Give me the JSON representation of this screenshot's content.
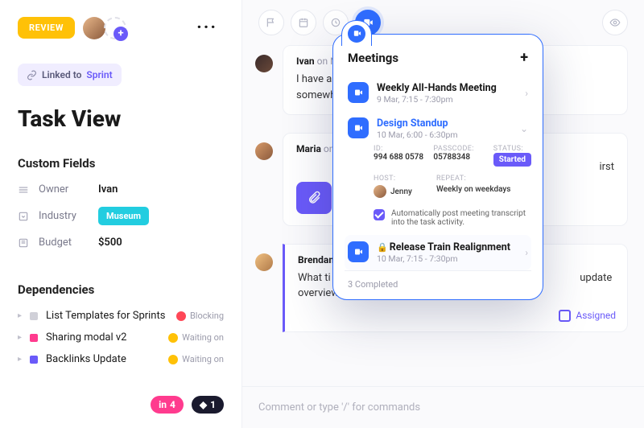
{
  "header": {
    "review_label": "REVIEW"
  },
  "linked": {
    "prefix": "Linked to ",
    "target": "Sprint"
  },
  "title": "Task View",
  "custom_fields": {
    "heading": "Custom Fields",
    "rows": [
      {
        "label": "Owner",
        "value": "Ivan",
        "kind": "text"
      },
      {
        "label": "Industry",
        "value": "Museum",
        "kind": "chip"
      },
      {
        "label": "Budget",
        "value": "$500",
        "kind": "text"
      }
    ]
  },
  "dependencies": {
    "heading": "Dependencies",
    "items": [
      {
        "label": "List Templates for Sprints",
        "color": "gray",
        "status": "Blocking"
      },
      {
        "label": "Sharing modal v2",
        "color": "pink",
        "status": "Waiting on"
      },
      {
        "label": "Backlinks Update",
        "color": "purp",
        "status": "Waiting on"
      }
    ]
  },
  "footer_tags": [
    {
      "label": "4",
      "kind": "pink"
    },
    {
      "label": "1",
      "kind": "dark"
    }
  ],
  "comments": [
    {
      "author": "Ivan",
      "meta": "on N",
      "text_before": "I have a",
      "text_after": " somewhere for what"
    },
    {
      "author": "Maria",
      "meta": "on",
      "tail": "irst",
      "has_attachment": true
    },
    {
      "author": "Brendan",
      "meta": "",
      "text": "What ti\noverview",
      "tail": "update",
      "assigned_label": "Assigned",
      "highlight": true
    }
  ],
  "composer": {
    "placeholder": "Comment or type '/' for commands"
  },
  "meetings": {
    "heading": "Meetings",
    "items": [
      {
        "title": "Weekly All-Hands Meeting",
        "sub": "9 Mar, 7:15 - 7:30pm"
      },
      {
        "title": "Design Standup",
        "sub": "10 Mar, 6:00 - 6:30pm",
        "expanded": true,
        "id_label": "ID:",
        "id": "994 688 0578",
        "pass_label": "PASSCODE:",
        "passcode": "05788348",
        "status_label": "STATUS:",
        "status": "Started",
        "host_label": "HOST:",
        "host": "Jenny",
        "repeat_label": "REPEAT:",
        "repeat": "Weekly on weekdays",
        "auto_label": "Automatically post meeting transcript into the task activity."
      },
      {
        "title": "Release Train Realignment",
        "sub": "10 Mar, 7:15 - 7:30pm",
        "locked": true
      }
    ],
    "completed_label": "3 Completed"
  }
}
